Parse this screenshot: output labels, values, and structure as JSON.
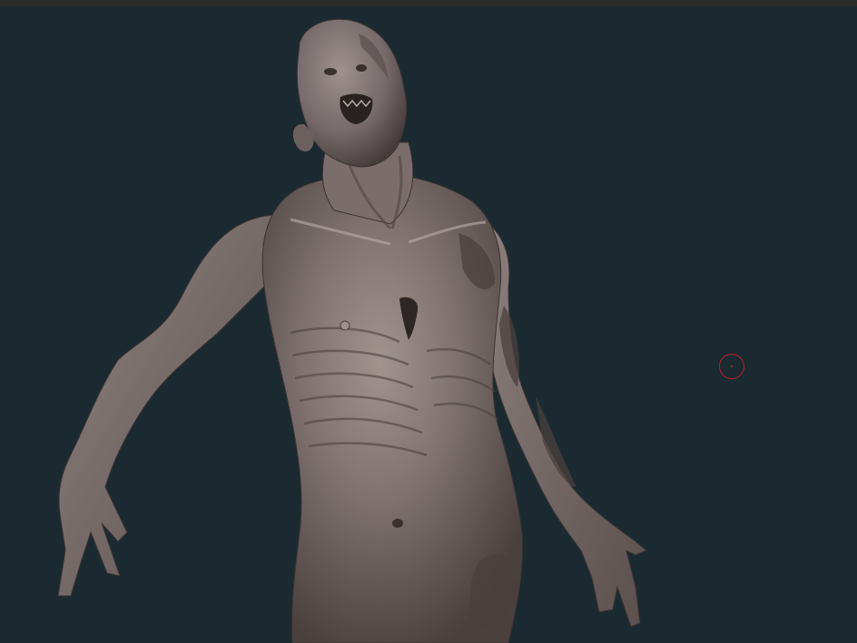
{
  "app": {
    "background_color": "#1a2a30",
    "topbar_color": "#2b2b2b"
  },
  "model": {
    "subject": "sculpted-zombie-torso",
    "material_color": "#7b6f6d",
    "highlight_color": "#a89c98",
    "shadow_color": "#3e3533"
  },
  "cursor": {
    "icon": "brush-circle-icon",
    "color": "#c0202a"
  }
}
